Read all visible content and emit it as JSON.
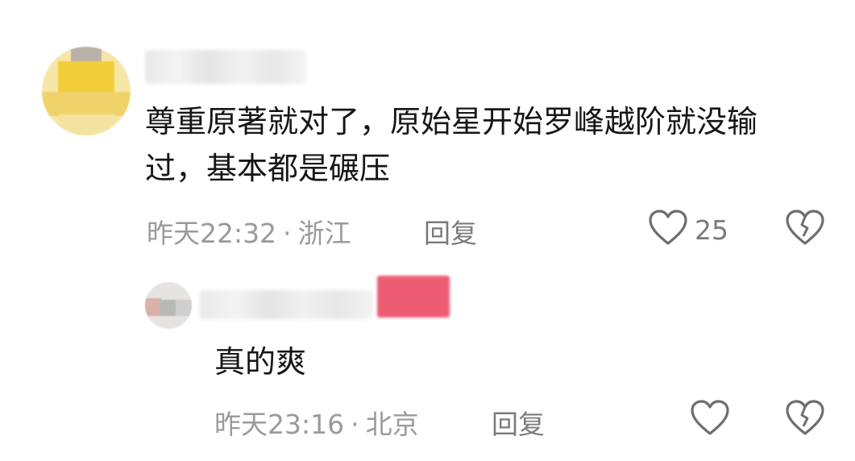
{
  "comments": [
    {
      "text": "尊重原著就对了，原始星开始罗峰越阶就没输过，基本都是碾压",
      "time": "昨天22:32",
      "separator": "·",
      "location": "浙江",
      "reply_label": "回复",
      "like_count": "25",
      "icons": {
        "like": "heart-outline-icon",
        "dislike": "broken-heart-icon"
      }
    },
    {
      "text": "真的爽",
      "time": "昨天23:16",
      "separator": "·",
      "location": "北京",
      "reply_label": "回复",
      "like_count": "",
      "icons": {
        "like": "heart-outline-icon",
        "dislike": "broken-heart-icon"
      }
    }
  ],
  "colors": {
    "text": "#161616",
    "meta": "#9a9a9a",
    "action": "#7b7b7b",
    "badge": "#ee5c73"
  }
}
